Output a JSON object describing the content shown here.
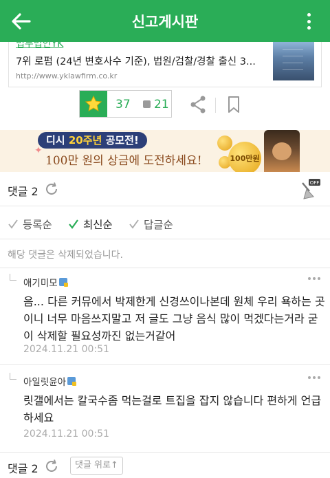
{
  "header": {
    "title": "신고게시판"
  },
  "ad": {
    "headline_partial": "법무법인YK",
    "description": "7위 로펌 (24년 변호사수 기준), 법원/검찰/경찰 출신 3...",
    "url": "http://www.yklawfirm.co.kr"
  },
  "votes": {
    "recommend_count": "37",
    "scrap_count": "21"
  },
  "banner": {
    "top_text": "디시",
    "top_highlight": "20주년",
    "top_text2": "공모전!",
    "main_text": "100만 원의 상금에 도전하세요!",
    "coin_label": "100만원"
  },
  "comments": {
    "label": "댓글 2",
    "off_label": "OFF",
    "sort": [
      "등록순",
      "최신순",
      "답글순"
    ],
    "active_sort": "최신순",
    "deleted_notice": "해당 댓글은 삭제되었습니다.",
    "replies": [
      {
        "nick": "애기미모",
        "body": "음... 다른 커뮤에서 박제한게 신경쓰이나본데 원체 우리 욕하는 곳이니 너무 마음쓰지말고 저 글도 그냥 음식 많이 먹겠다는거라 굳이 삭제할 필요성까진 없는거같어",
        "time": "2024.11.21 00:51"
      },
      {
        "nick": "아일릿윤아",
        "body": "릿갤에서는 칼국수좀 먹는걸로 트집을 잡지 않습니다 편하게 언급하세요",
        "time": "2024.11.21 00:51"
      }
    ]
  },
  "footer": {
    "label": "댓글 2",
    "up_button": "댓글 위로↑"
  },
  "colors": {
    "brand": "#2aad57"
  }
}
